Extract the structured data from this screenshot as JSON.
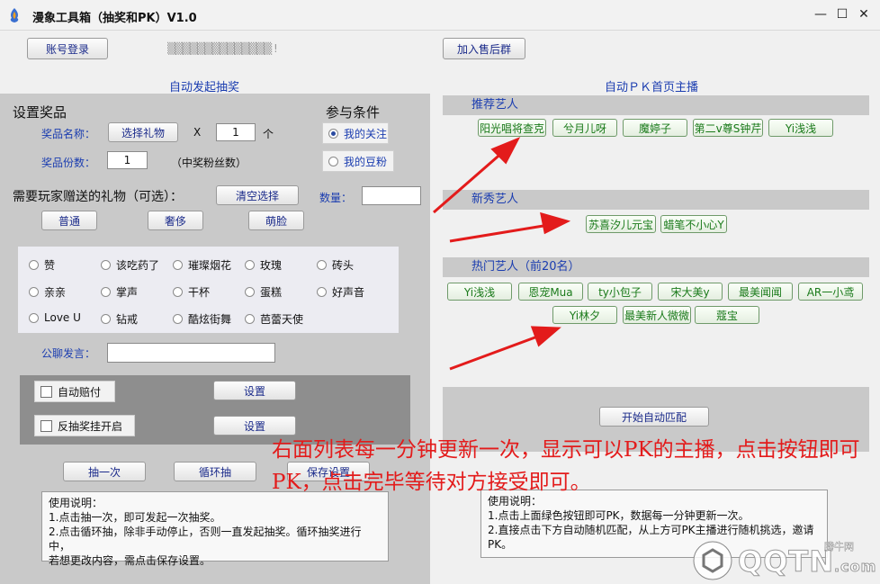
{
  "window": {
    "title": "漫象工具箱（抽奖和PK）V1.0",
    "controls": {
      "minimize": "—",
      "maximize": "☐",
      "close": "✕"
    }
  },
  "header": {
    "login_button": "账号登录",
    "account_name": "▒▒▒▒▒▒▒▒▒▒▒▒▒▒ !",
    "join_group_button": "加入售后群"
  },
  "lottery": {
    "section_title": "自动发起抽奖",
    "prize_heading": "设置奖品",
    "prize_name_label": "奖品名称：",
    "select_gift_button": "选择礼物",
    "times_symbol": "X",
    "gift_count_value": "1",
    "gift_count_unit": "个",
    "prize_copies_label": "奖品份数：",
    "prize_copies_value": "1",
    "prize_copies_note": "（中奖粉丝数）",
    "condition_heading": "参与条件",
    "condition_options": [
      {
        "label": "我的关注",
        "checked": true
      },
      {
        "label": "我的豆粉",
        "checked": false
      }
    ],
    "required_gift_label": "需要玩家赠送的礼物（可选）：",
    "clear_button": "清空选择",
    "quantity_label": "数量：",
    "quantity_value": "",
    "tier_buttons": [
      "普通",
      "奢侈",
      "萌脸"
    ],
    "gifts": [
      "赞",
      "该吃药了",
      "璀璨烟花",
      "玫瑰",
      "砖头",
      "亲亲",
      "掌声",
      "干杯",
      "蛋糕",
      "好声音",
      "Love U",
      "钻戒",
      "酷炫街舞",
      "芭蕾天使"
    ],
    "public_chat_label": "公聊发言：",
    "public_chat_value": "",
    "auto_pay_label": "自动赔付",
    "auto_pay_button": "设置",
    "anti_cheat_label": "反抽奖挂开启",
    "anti_cheat_button": "设置",
    "draw_once_button": "抽一次",
    "loop_draw_button": "循环抽",
    "save_settings_button": "保存设置",
    "instructions": [
      "使用说明：",
      "1.点击抽一次，即可发起一次抽奖。",
      "2.点击循环抽，除非手动停止，否则一直发起抽奖。循环抽奖进行中，",
      "若想更改内容，需点击保存设置。"
    ]
  },
  "pk": {
    "section_title": "自动ＰＫ首页主播",
    "recommended_title": "推荐艺人",
    "recommended": [
      "阳光唱将查克",
      "兮月儿呀",
      "魔婷子",
      "第二v尊S钟芹",
      "Yi浅浅"
    ],
    "newcomer_title": "新秀艺人",
    "newcomers": [
      "苏喜汐儿元宝",
      "蜡笔不小心Y"
    ],
    "popular_title": "热门艺人（前20名）",
    "popular_row1": [
      "Yi浅浅",
      "恩宠Mua",
      "ty小包子",
      "宋大美y",
      "最美闻闻",
      "AR一小鸢"
    ],
    "popular_row2": [
      "Yi林夕",
      "最美新人微微",
      "蔻宝"
    ],
    "auto_match_button": "开始自动匹配",
    "instructions": [
      "使用说明：",
      "1.点击上面绿色按钮即可PK，数据每一分钟更新一次。",
      "2.直接点击下方自动随机匹配，从上方可PK主播进行随机挑选，邀请",
      "PK。"
    ]
  },
  "annotation": {
    "text": "右面列表每一分钟更新一次，显示可以PK的主播，点击按钮即可PK，点击完毕等待对方接受即可。",
    "color": "#e31b1b"
  },
  "watermark": {
    "brand": "QQTN",
    "domain": ".com",
    "site_cn": "腾牛网"
  },
  "colors": {
    "accent_blue": "#1b3db0",
    "green_text": "#1a7a1a",
    "panel_gray": "#c9c9c9",
    "dark_gray": "#8e8e8e"
  }
}
